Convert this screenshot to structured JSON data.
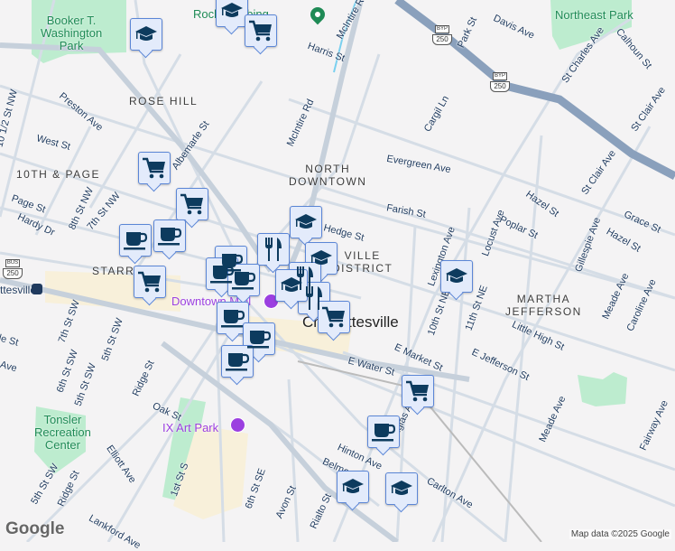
{
  "map": {
    "neighborhoods": {
      "rose_hill": "ROSE HILL",
      "tenth_page": "10TH & PAGE",
      "north_downtown": "NORTH\nDOWNTOWN",
      "martha_jefferson": "MARTHA\nJEFFERSON",
      "starr_hill": "STARR HILL",
      "district": "VILLE\nDISTRICT"
    },
    "city": "Charlottesville",
    "parks": {
      "booker": "Booker T.\nWashington\nPark",
      "northeast": "Northeast Park",
      "tonsler": "Tonsler\nRecreation\nCenter"
    },
    "pois": {
      "rock_climbing": "Rock Climbing",
      "downtown_mall": "Downtown Mall",
      "ix_art_park": "IX Art Park",
      "station": "ttesville"
    },
    "shields": {
      "byp": "BYP",
      "bus": "BUS",
      "route": "250"
    },
    "streets": [
      "Preston Ave",
      "West St",
      "10 1/2 St NW",
      "Albemarle St",
      "Page St",
      "8th St NW",
      "7th St NW",
      "Hardy Dr",
      "Harris St",
      "McIntire Rd",
      "McIntire Rd",
      "Park St",
      "Davis Ave",
      "St Charles Ave",
      "Calhoun St",
      "Cargil Ln",
      "Evergreen Ave",
      "Farish St",
      "Hedge St",
      "Lexington Ave",
      "Locust Ave",
      "Poplar St",
      "Hazel St",
      "St Clair Ave",
      "St Clair Ave",
      "Gillespie Ave",
      "Grace St",
      "Hazel St",
      "10th St NE",
      "11th St NE",
      "Little High St",
      "Meade Ave",
      "Caroline Ave",
      "E Market St",
      "E Jefferson St",
      "E Water St",
      "Meade Ave",
      "Fairway Ave",
      "Douglas Ave",
      "Hinton Ave",
      "Carlton Ave",
      "Belmont",
      "Rialto St",
      "Avon St",
      "6th St SE",
      "1st St S",
      "Elliott Ave",
      "Ridge St",
      "Oak St",
      "5th St SW",
      "Ridge St",
      "Lankford Ave",
      "6th St SW",
      "5th St SW",
      "7th St SW",
      "5th St SW",
      "Ave",
      "alle St"
    ],
    "markers": [
      "graduation-cap",
      "shopping-cart",
      "graduation-cap",
      "shopping-cart",
      "shopping-cart",
      "coffee",
      "coffee",
      "graduation-cap",
      "fork-knife",
      "coffee",
      "coffee",
      "coffee",
      "graduation-cap",
      "shopping-cart",
      "fork-knife",
      "coffee",
      "coffee",
      "coffee",
      "fork-knife",
      "shopping-cart",
      "graduation-cap",
      "graduation-cap",
      "shopping-cart",
      "coffee",
      "graduation-cap",
      "graduation-cap"
    ],
    "colors": {
      "marker_bg": "#e3ebfb",
      "marker_border": "#5b86d6",
      "icon": "#0d3b5e",
      "park": "#bdeccf",
      "downtown": "#f8f0da",
      "highway": "#8aa0bc"
    },
    "attribution": "Map data ©2025 Google",
    "logo": "Google"
  }
}
